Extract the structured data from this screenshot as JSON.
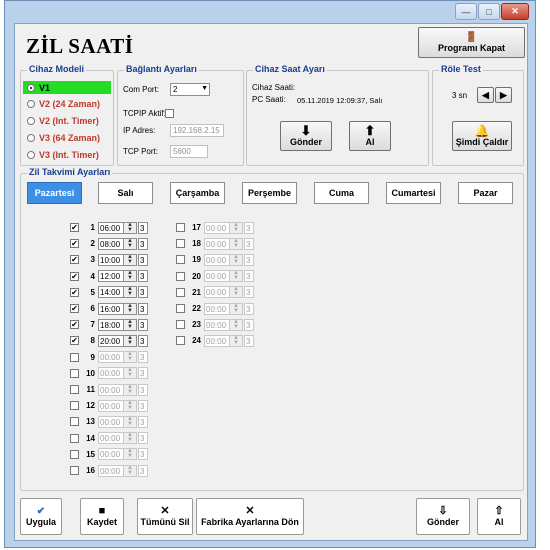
{
  "window": {
    "title_buttons": {
      "minimize": "—",
      "maximize": "□",
      "close": "✕"
    }
  },
  "app_title": "ZİL SAATİ",
  "close_program_label": "Programı Kapat",
  "device_model": {
    "title": "Cihaz Modeli",
    "options": [
      "V1",
      "V2 (24 Zaman)",
      "V2 (Int. Timer)",
      "V3 (64 Zaman)",
      "V3 (Int. Timer)"
    ],
    "selected": "V1"
  },
  "connection": {
    "title": "Bağlantı Ayarları",
    "com_port_label": "Com Port:",
    "com_port_value": "2",
    "tcpip_label": "TCPIP Aktif:",
    "ip_label": "IP Adres:",
    "ip_value": "192.168.2.15",
    "tcp_port_label": "TCP Port:",
    "tcp_port_value": "5600"
  },
  "device_clock": {
    "title": "Cihaz Saat Ayarı",
    "device_time_label": "Cihaz Saati:",
    "pc_time_label": "PC Saati:",
    "pc_time_value": "05.11.2019 12:09:37, Salı",
    "send_label": "Gönder",
    "receive_label": "Al"
  },
  "relay_test": {
    "title": "Röle Test",
    "duration_value": "3 sn",
    "ring_now_label": "Şimdi Çaldır"
  },
  "schedule": {
    "title": "Zil Takvimi Ayarları",
    "days": [
      "Pazartesi",
      "Salı",
      "Çarşamba",
      "Perşembe",
      "Cuma",
      "Cumartesi",
      "Pazar"
    ],
    "active_day": "Pazartesi",
    "rows": [
      {
        "n": "1",
        "time": "06:00",
        "count": "3",
        "checked": true
      },
      {
        "n": "2",
        "time": "08:00",
        "count": "3",
        "checked": true
      },
      {
        "n": "3",
        "time": "10:00",
        "count": "3",
        "checked": true
      },
      {
        "n": "4",
        "time": "12:00",
        "count": "3",
        "checked": true
      },
      {
        "n": "5",
        "time": "14:00",
        "count": "3",
        "checked": true
      },
      {
        "n": "6",
        "time": "16:00",
        "count": "3",
        "checked": true
      },
      {
        "n": "7",
        "time": "18:00",
        "count": "3",
        "checked": true
      },
      {
        "n": "8",
        "time": "20:00",
        "count": "3",
        "checked": true
      },
      {
        "n": "9",
        "time": "00:00",
        "count": "3",
        "checked": false
      },
      {
        "n": "10",
        "time": "00:00",
        "count": "3",
        "checked": false
      },
      {
        "n": "11",
        "time": "00:00",
        "count": "3",
        "checked": false
      },
      {
        "n": "12",
        "time": "00:00",
        "count": "3",
        "checked": false
      },
      {
        "n": "13",
        "time": "00:00",
        "count": "3",
        "checked": false
      },
      {
        "n": "14",
        "time": "00:00",
        "count": "3",
        "checked": false
      },
      {
        "n": "15",
        "time": "00:00",
        "count": "3",
        "checked": false
      },
      {
        "n": "16",
        "time": "00:00",
        "count": "3",
        "checked": false
      },
      {
        "n": "17",
        "time": "00:00",
        "count": "3",
        "checked": false
      },
      {
        "n": "18",
        "time": "00:00",
        "count": "3",
        "checked": false
      },
      {
        "n": "19",
        "time": "00:00",
        "count": "3",
        "checked": false
      },
      {
        "n": "20",
        "time": "00:00",
        "count": "3",
        "checked": false
      },
      {
        "n": "21",
        "time": "00:00",
        "count": "3",
        "checked": false
      },
      {
        "n": "22",
        "time": "00:00",
        "count": "3",
        "checked": false
      },
      {
        "n": "23",
        "time": "00:00",
        "count": "3",
        "checked": false
      },
      {
        "n": "24",
        "time": "00:00",
        "count": "3",
        "checked": false
      }
    ]
  },
  "bottom_toolbar": {
    "apply_label": "Uygula",
    "save_label": "Kaydet",
    "delete_all_label": "Tümünü Sil",
    "factory_reset_label": "Fabrika Ayarlarına Dön",
    "send_label": "Gönder",
    "receive_label": "Al"
  },
  "colors": {
    "selected_model_bg": "#22dd22",
    "active_tab_bg": "#3d8fe6",
    "group_title": "#1a3d8f",
    "model_text": "#c0392b"
  }
}
